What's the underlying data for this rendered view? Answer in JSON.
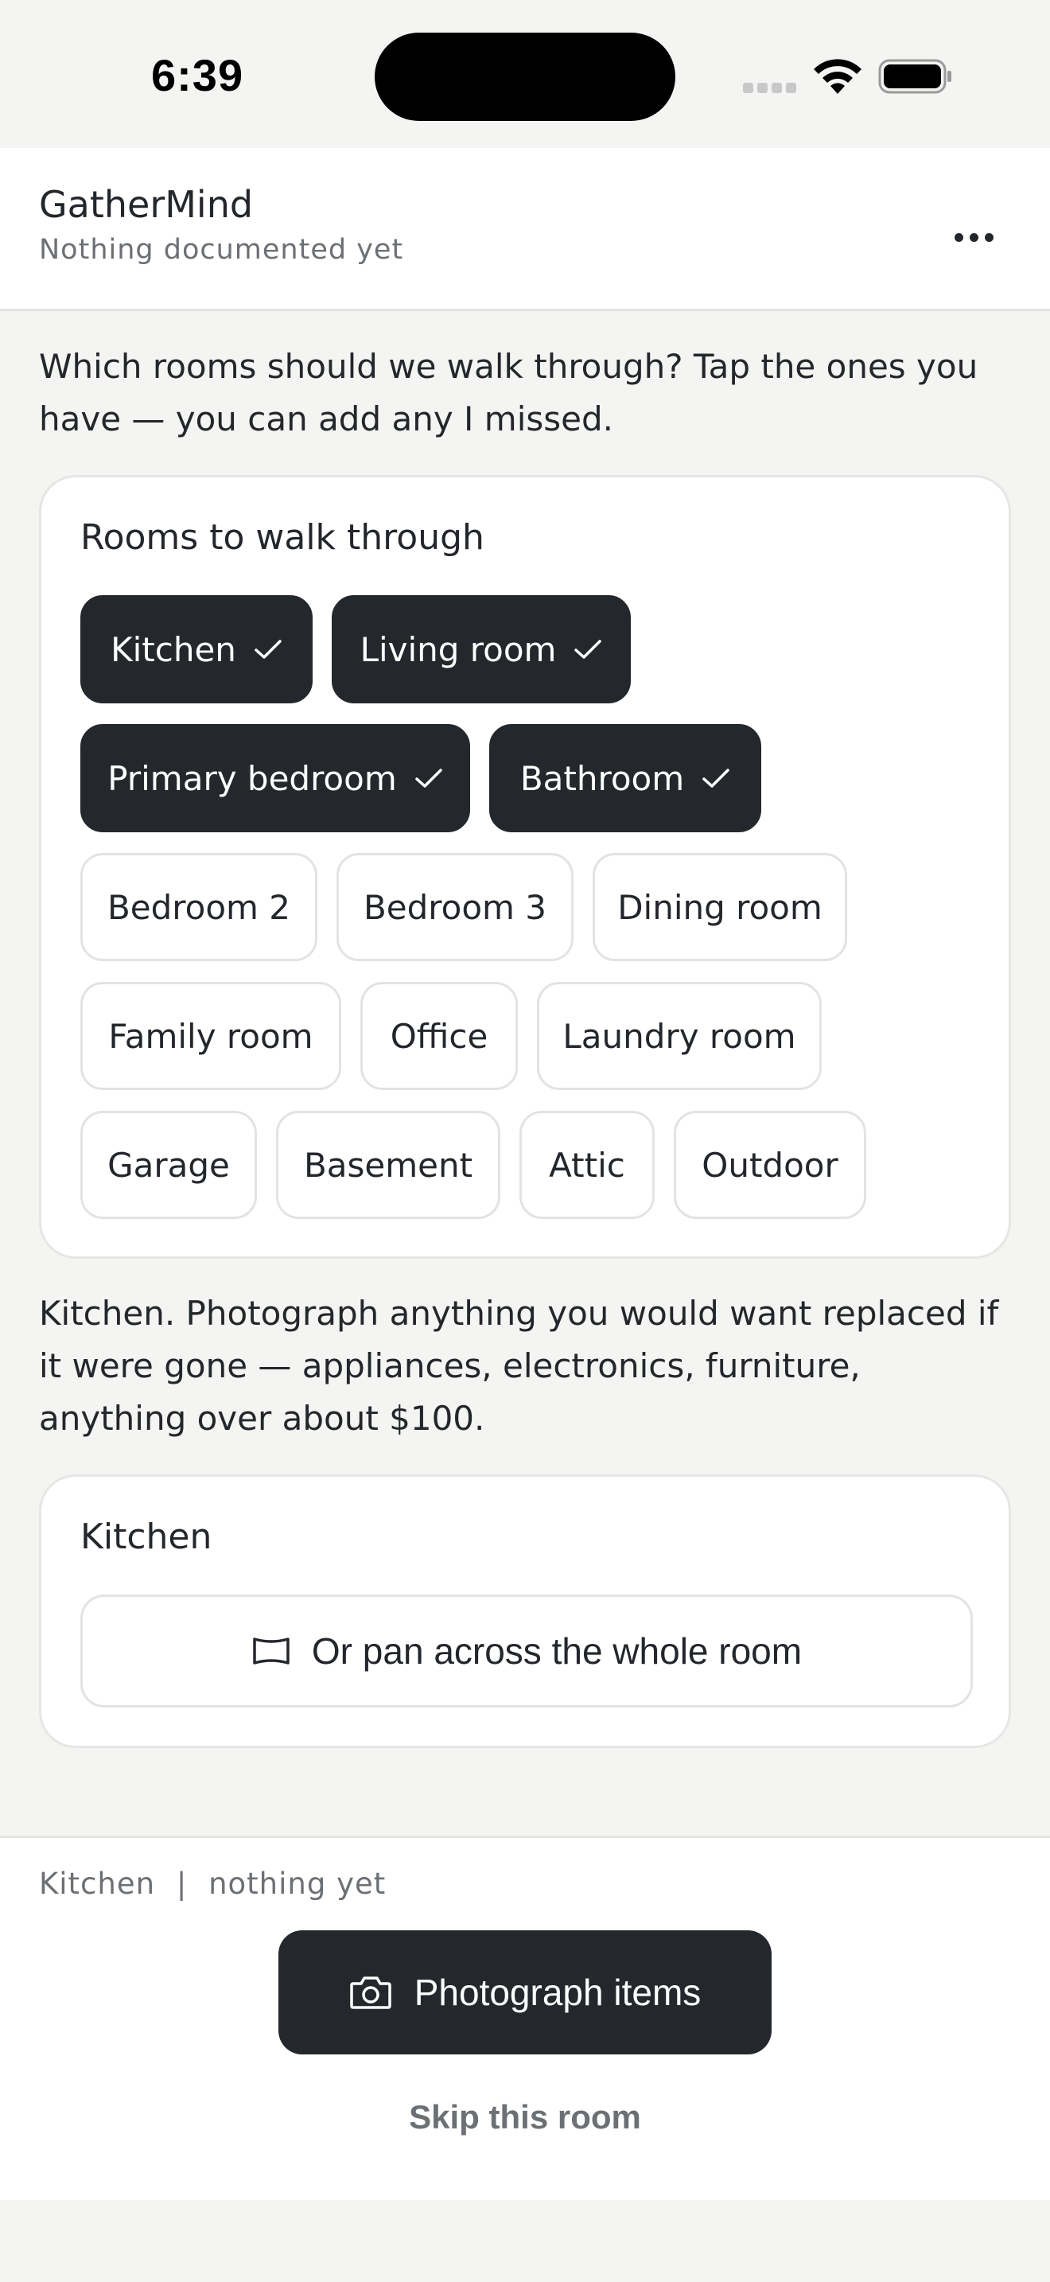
{
  "status_bar": {
    "time": "6:39"
  },
  "header": {
    "title": "GatherMind",
    "subtitle": "Nothing documented yet",
    "more_icon": "more-horizontal-icon"
  },
  "chat": {
    "rooms_prompt": "Which rooms should we walk through? Tap the ones you have — you can add any I missed.",
    "room_picker": {
      "title": "Rooms to walk through",
      "rooms": [
        {
          "label": "Kitchen",
          "selected": true
        },
        {
          "label": "Living room",
          "selected": true
        },
        {
          "label": "Primary bedroom",
          "selected": true
        },
        {
          "label": "Bathroom",
          "selected": true
        },
        {
          "label": "Bedroom 2",
          "selected": false
        },
        {
          "label": "Bedroom 3",
          "selected": false
        },
        {
          "label": "Dining room",
          "selected": false
        },
        {
          "label": "Family room",
          "selected": false
        },
        {
          "label": "Office",
          "selected": false
        },
        {
          "label": "Laundry room",
          "selected": false
        },
        {
          "label": "Garage",
          "selected": false
        },
        {
          "label": "Basement",
          "selected": false
        },
        {
          "label": "Attic",
          "selected": false
        },
        {
          "label": "Outdoor",
          "selected": false
        }
      ]
    },
    "room_instruction": "Kitchen. Photograph anything you would want replaced if it were gone — appliances, electronics, furniture, anything over about $100.",
    "room_card": {
      "title": "Kitchen",
      "pan_button": "Or pan across the whole room",
      "pan_icon": "panorama-icon"
    }
  },
  "footer": {
    "current_room": "Kitchen",
    "separator": "|",
    "item_status": "nothing yet",
    "photograph_button": "Photograph items",
    "photograph_icon": "camera-icon",
    "skip_button": "Skip this room"
  },
  "colors": {
    "background": "#f4f4f3",
    "surface": "#ffffff",
    "selected_chip": "#24282c",
    "text_primary": "#23272b",
    "text_secondary": "#6c7074",
    "border": "#e3e3e1"
  }
}
